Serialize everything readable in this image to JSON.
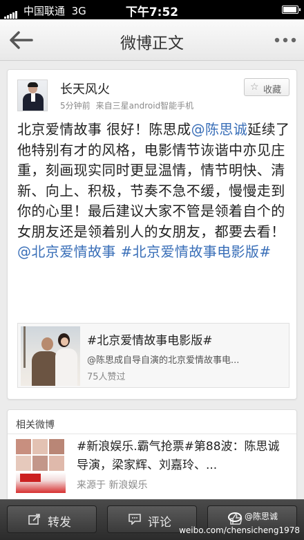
{
  "status_bar": {
    "carrier": "中国联通",
    "network": "3G",
    "time": "下午7:52"
  },
  "nav": {
    "title": "微博正文"
  },
  "post": {
    "username": "长天风火",
    "time_ago": "5分钟前",
    "source": "来自三星android智能手机",
    "favorite_label": "收藏",
    "text_parts": [
      "北京爱情故事 很好！陈思成",
      "@陈思诚",
      "延续了他特别有才的风格，电影情节诙谐中亦见庄重，刻画现实同时更显温情，情节明快、清新、向上、积极，节奏不急不缓，慢慢走到你的心里！最后建议大家不管是领着自个的女朋友还是领着别人的女朋友，都要去看！",
      "@北京爱情故事",
      " ",
      "#北京爱情故事电影版#"
    ],
    "attachment": {
      "title": "#北京爱情故事电影版#",
      "description": "@陈思成自导自演的北京爱情故事电...",
      "likes": "75人赞过"
    }
  },
  "related": {
    "header": "相关微博",
    "item": {
      "text": "#新浪娱乐.霸气抢票#第88波：陈思诚导演，梁家辉、刘嘉玲、...",
      "source": "来源于 新浪娱乐"
    }
  },
  "toolbar": {
    "repost": "转发",
    "comment": "评论"
  },
  "watermark": {
    "handle": "@陈思诚",
    "url": "weibo.com/chensicheng1978"
  },
  "colors": {
    "link": "#3a6fb8",
    "toolbar_bg": "#3a3a3a"
  }
}
